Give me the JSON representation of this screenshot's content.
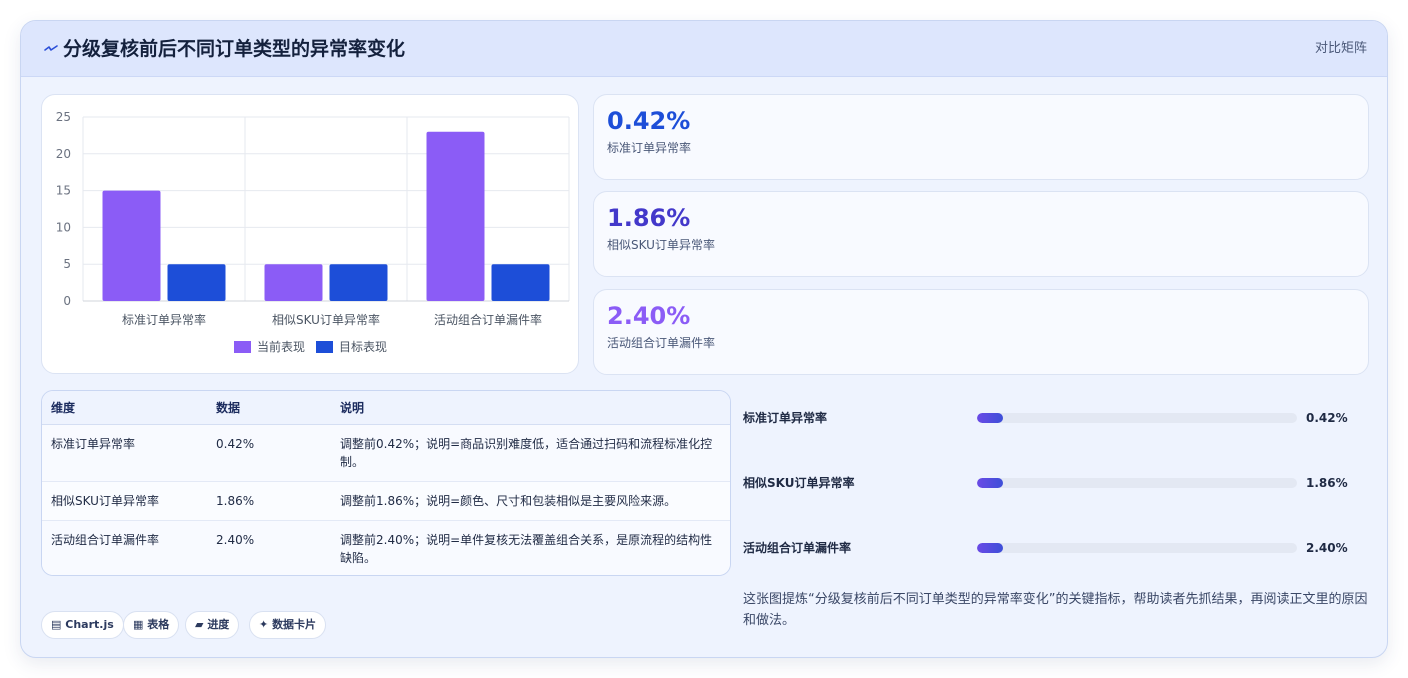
{
  "header": {
    "title": "分级复核前后不同订单类型的异常率变化",
    "tag": "对比矩阵",
    "logo_icon": "lightning-icon"
  },
  "chart_data": {
    "type": "bar",
    "categories": [
      "标准订单异常率",
      "相似SKU订单异常率",
      "活动组合订单漏件率"
    ],
    "series": [
      {
        "name": "当前表现",
        "values": [
          15,
          5,
          23
        ],
        "color": "#8b5cf6"
      },
      {
        "name": "目标表现",
        "values": [
          5,
          5,
          5
        ],
        "color": "#1d4ed8"
      }
    ],
    "y_ticks": [
      "0",
      "5",
      "10",
      "15",
      "20",
      "25"
    ],
    "ylim": [
      0,
      25
    ],
    "grid": true,
    "legend": "bottom"
  },
  "kpis": [
    {
      "value": "0.42%",
      "label": "标准订单异常率",
      "color": "#1d4ed8"
    },
    {
      "value": "1.86%",
      "label": "相似SKU订单异常率",
      "color": "#4338ca"
    },
    {
      "value": "2.40%",
      "label": "活动组合订单漏件率",
      "color": "#8b5cf6"
    }
  ],
  "table": {
    "headers": [
      "维度",
      "数据",
      "说明"
    ],
    "rows": [
      [
        "标准订单异常率",
        "0.42%",
        "调整前0.42%；说明=商品识别难度低，适合通过扫码和流程标准化控制。"
      ],
      [
        "相似SKU订单异常率",
        "1.86%",
        "调整前1.86%；说明=颜色、尺寸和包装相似是主要风险来源。"
      ],
      [
        "活动组合订单漏件率",
        "2.40%",
        "调整前2.40%；说明=单件复核无法覆盖组合关系，是原流程的结构性缺陷。"
      ]
    ]
  },
  "chips": [
    {
      "icon": "chart-icon",
      "glyph": "▤",
      "label": "Chart.js"
    },
    {
      "icon": "table-icon",
      "glyph": "▦",
      "label": "表格"
    },
    {
      "icon": "progress-icon",
      "glyph": "▰",
      "label": "进度"
    },
    {
      "icon": "sparkle-icon",
      "glyph": "✦",
      "label": "数据卡片"
    }
  ],
  "progress": [
    {
      "label": "标准订单异常率",
      "value": "0.42%",
      "fraction": 0.08
    },
    {
      "label": "相似SKU订单异常率",
      "value": "1.86%",
      "fraction": 0.08
    },
    {
      "label": "活动组合订单漏件率",
      "value": "2.40%",
      "fraction": 0.08
    }
  ],
  "summary": "这张图提炼“分级复核前后不同订单类型的异常率变化”的关键指标，帮助读者先抓结果，再阅读正文里的原因和做法。"
}
